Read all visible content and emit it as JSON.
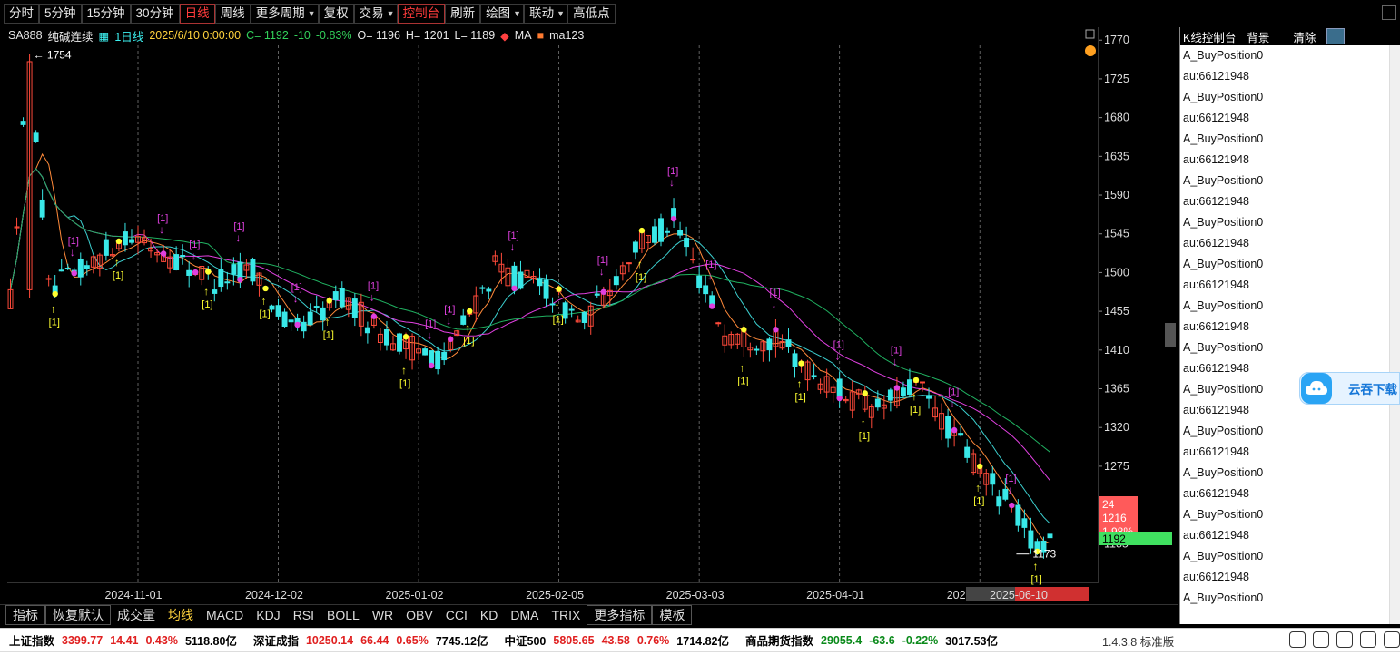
{
  "toolbar": {
    "items": [
      "分时",
      "5分钟",
      "15分钟",
      "30分钟",
      "日线",
      "周线",
      "更多周期",
      "复权",
      "交易",
      "控制台",
      "刷新",
      "绘图",
      "联动",
      "高低点"
    ],
    "active": [
      "日线",
      "控制台"
    ]
  },
  "info_bar": {
    "symbol": "SA888",
    "name": "纯碱连续",
    "period": "1日线",
    "datetime": "2025/6/10 0:00:00",
    "close_label": "C=",
    "close": "1192",
    "change": "-10",
    "change_pct": "-0.83%",
    "open_label": "O=",
    "open": "1196",
    "high_label": "H=",
    "high": "1201",
    "low_label": "L=",
    "low": "1189",
    "ma_label": "MA",
    "ma_series": "ma123"
  },
  "chart_data": {
    "type": "candlestick",
    "y_axis": {
      "min": 1140,
      "max": 1785,
      "ticks": [
        1770,
        1725,
        1680,
        1635,
        1590,
        1545,
        1500,
        1455,
        1410,
        1365,
        1320,
        1275,
        1230,
        1185
      ]
    },
    "x_ticks": [
      "2024-11-01",
      "2024-12-02",
      "2025-01-02",
      "2025-02-05",
      "2025-03-03",
      "2025-04-01",
      "2025-05-06",
      "2025-06-10"
    ],
    "high_marker": "1754",
    "low_marker": "1173",
    "signal_label": "[1]",
    "price_tag": {
      "count": "24",
      "price": "1216",
      "pct": "1.98%"
    },
    "last_price": "1192",
    "colors": {
      "up": "#ff4a3a",
      "down": "#39e8e8",
      "ma_fast": "#ff8a3a",
      "ma_mid": "#3cd0d0",
      "ma_slow": "#e040e0",
      "ma_long": "#20b060",
      "buy": "#ffff30",
      "sell": "#e040e0"
    }
  },
  "indicator_tabs": [
    "指标",
    "恢复默认",
    "成交量",
    "均线",
    "MACD",
    "KDJ",
    "RSI",
    "BOLL",
    "WR",
    "OBV",
    "CCI",
    "KD",
    "DMA",
    "TRIX",
    "更多指标",
    "模板"
  ],
  "side_panel": {
    "title": "K线控制台",
    "bg_button": "背景",
    "clear_button": "清除",
    "entries": [
      "A_BuyPosition0",
      "au:66121948",
      "A_BuyPosition0",
      "au:66121948",
      "A_BuyPosition0",
      "au:66121948",
      "A_BuyPosition0",
      "au:66121948",
      "A_BuyPosition0",
      "au:66121948",
      "A_BuyPosition0",
      "au:66121948",
      "A_BuyPosition0",
      "au:66121948",
      "A_BuyPosition0",
      "au:66121948",
      "A_BuyPosition0",
      "au:66121948",
      "A_BuyPosition0",
      "au:66121948",
      "A_BuyPosition0",
      "au:66121948",
      "A_BuyPosition0",
      "au:66121948",
      "A_BuyPosition0",
      "au:66121948",
      "A_BuyPosition0"
    ]
  },
  "cloud_widget": {
    "label": "云吞下载"
  },
  "status_bar": {
    "shanghai": {
      "name": "上证指数",
      "value": "3399.77",
      "change": "14.41",
      "pct": "0.43%",
      "amount": "5118.80亿"
    },
    "shenzhen": {
      "name": "深证成指",
      "value": "10250.14",
      "change": "66.44",
      "pct": "0.65%",
      "amount": "7745.12亿"
    },
    "zz500": {
      "name": "中证500",
      "value": "5805.65",
      "change": "43.58",
      "pct": "0.76%",
      "amount": "1714.82亿"
    },
    "commodity": {
      "name": "商品期货指数",
      "value": "29055.4",
      "change": "-63.6",
      "pct": "-0.22%",
      "amount": "3017.53亿"
    },
    "version": "1.4.3.8 标准版"
  }
}
